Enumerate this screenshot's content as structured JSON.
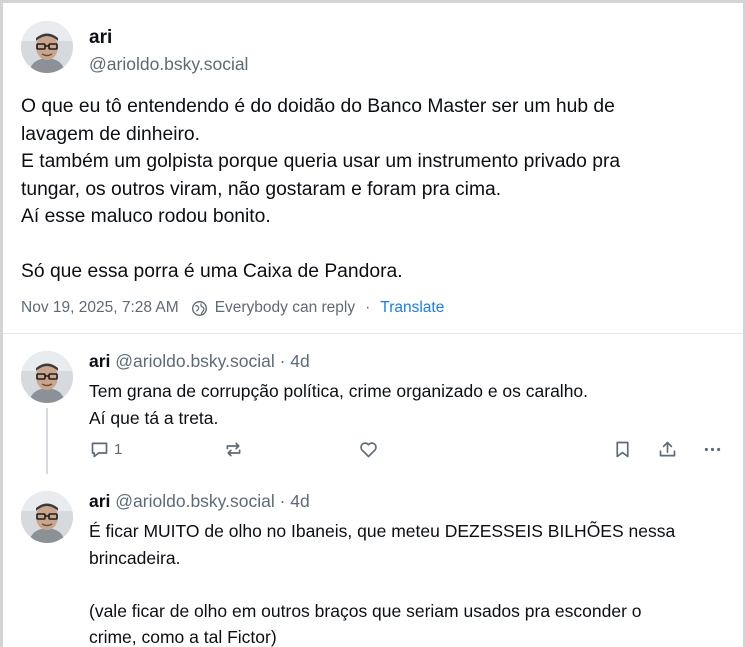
{
  "post": {
    "author_name": "ari",
    "author_handle": "@arioldo.bsky.social",
    "text": "O que eu tô entendendo é do doidão do Banco Master ser um hub de\nlavagem de dinheiro.\nE também um golpista porque queria usar um instrumento privado pra\ntungar, os outros viram, não gostaram e foram pra cima.\nAí esse maluco rodou bonito.\n\nSó que essa porra é uma Caixa de Pandora.",
    "timestamp": "Nov 19, 2025, 7:28 AM",
    "reply_permission": "Everybody can reply",
    "separator": "·",
    "translate_label": "Translate"
  },
  "replies": [
    {
      "author_name": "ari",
      "author_handle": "@arioldo.bsky.social",
      "age": "· 4d",
      "text": "Tem grana de corrupção política, crime organizado e os caralho.\nAí que tá a treta.",
      "reply_count": "1"
    },
    {
      "author_name": "ari",
      "author_handle": "@arioldo.bsky.social",
      "age": "· 4d",
      "text": "É ficar MUITO de olho no Ibaneis, que meteu DEZESSEIS BILHÕES nessa\nbrincadeira.\n\n(vale ficar de olho em outros braços que seriam usados pra esconder o\ncrime, como a tal Fictor)"
    }
  ],
  "colors": {
    "link": "#1b7cf2",
    "muted": "#5e6a77",
    "text": "#0b0f14"
  },
  "icons": [
    "globe-icon",
    "reply-icon",
    "repost-icon",
    "like-icon",
    "bookmark-icon",
    "share-icon",
    "more-icon"
  ]
}
